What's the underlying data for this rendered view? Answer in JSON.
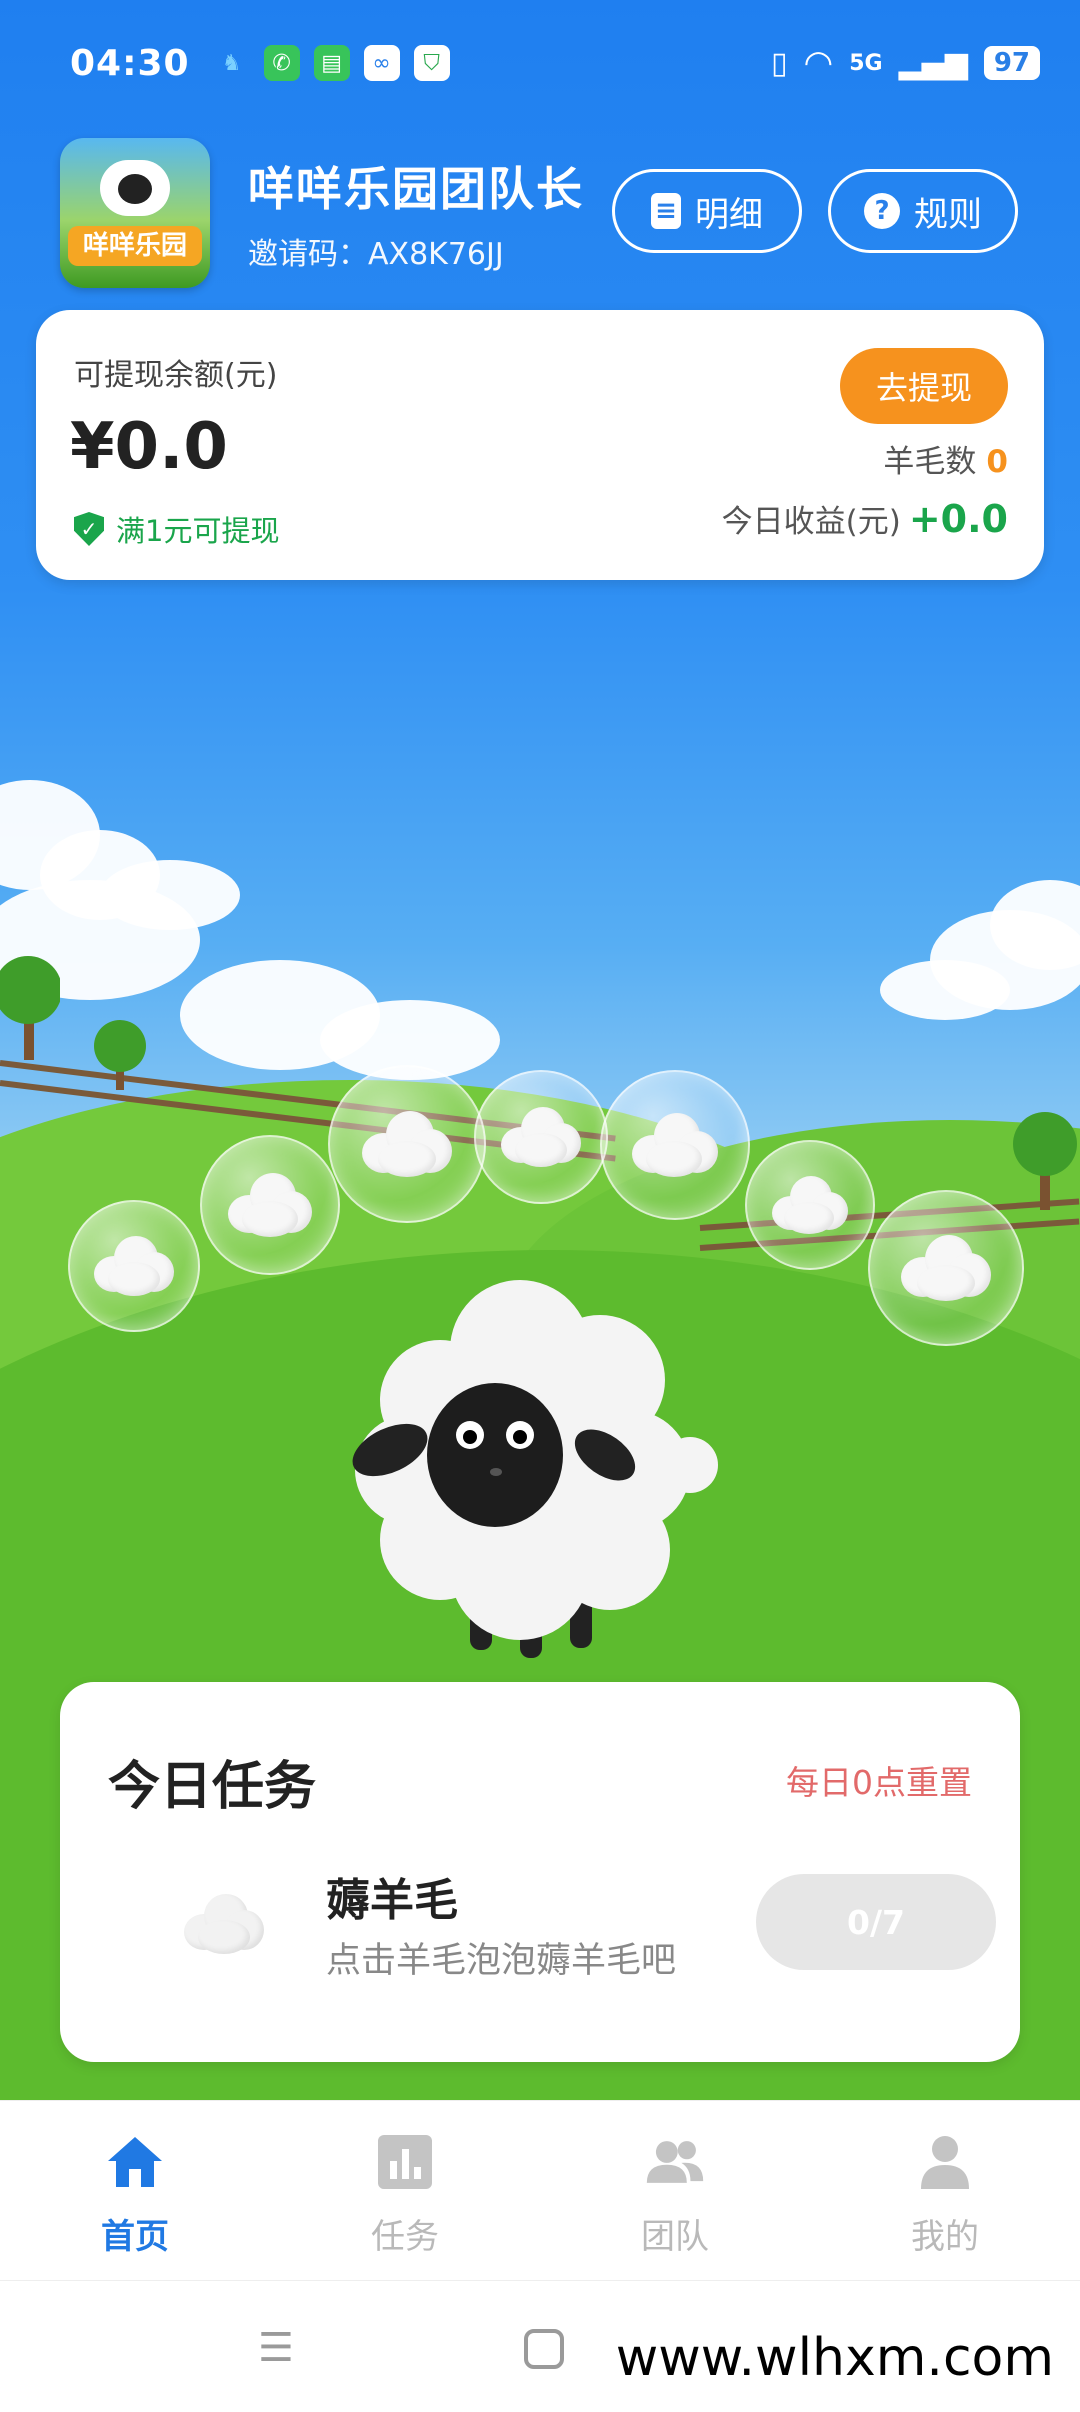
{
  "status_bar": {
    "time": "04:30",
    "battery": "97",
    "network": "5G"
  },
  "header": {
    "app_title": "咩咩乐园团队长",
    "invite_code": "邀请码：AX8K76JJ",
    "detail_button": "明细",
    "rules_button": "规则",
    "logo_text": "咩咩乐园"
  },
  "balance_card": {
    "label": "可提现余额(元)",
    "amount": "¥0.0",
    "withdraw_condition": "满1元可提现",
    "withdraw_button": "去提现",
    "wool_count_label": "羊毛数",
    "wool_count": "0",
    "today_income_label": "今日收益(元)",
    "today_income": "+0.0"
  },
  "tasks": {
    "title": "今日任务",
    "reset_note": "每日0点重置",
    "items": [
      {
        "name": "薅羊毛",
        "description": "点击羊毛泡泡薅羊毛吧",
        "progress": "0/7"
      }
    ]
  },
  "tab_bar": {
    "tabs": [
      {
        "label": "首页",
        "icon": "home-icon",
        "active": true
      },
      {
        "label": "任务",
        "icon": "chart-icon",
        "active": false
      },
      {
        "label": "团队",
        "icon": "team-icon",
        "active": false
      },
      {
        "label": "我的",
        "icon": "person-icon",
        "active": false
      }
    ]
  },
  "watermark": "www.wlhxm.com",
  "colors": {
    "primary": "#2079e3",
    "accent": "#f6921e",
    "success": "#1aa54b",
    "reset_red": "#e26a6a"
  }
}
